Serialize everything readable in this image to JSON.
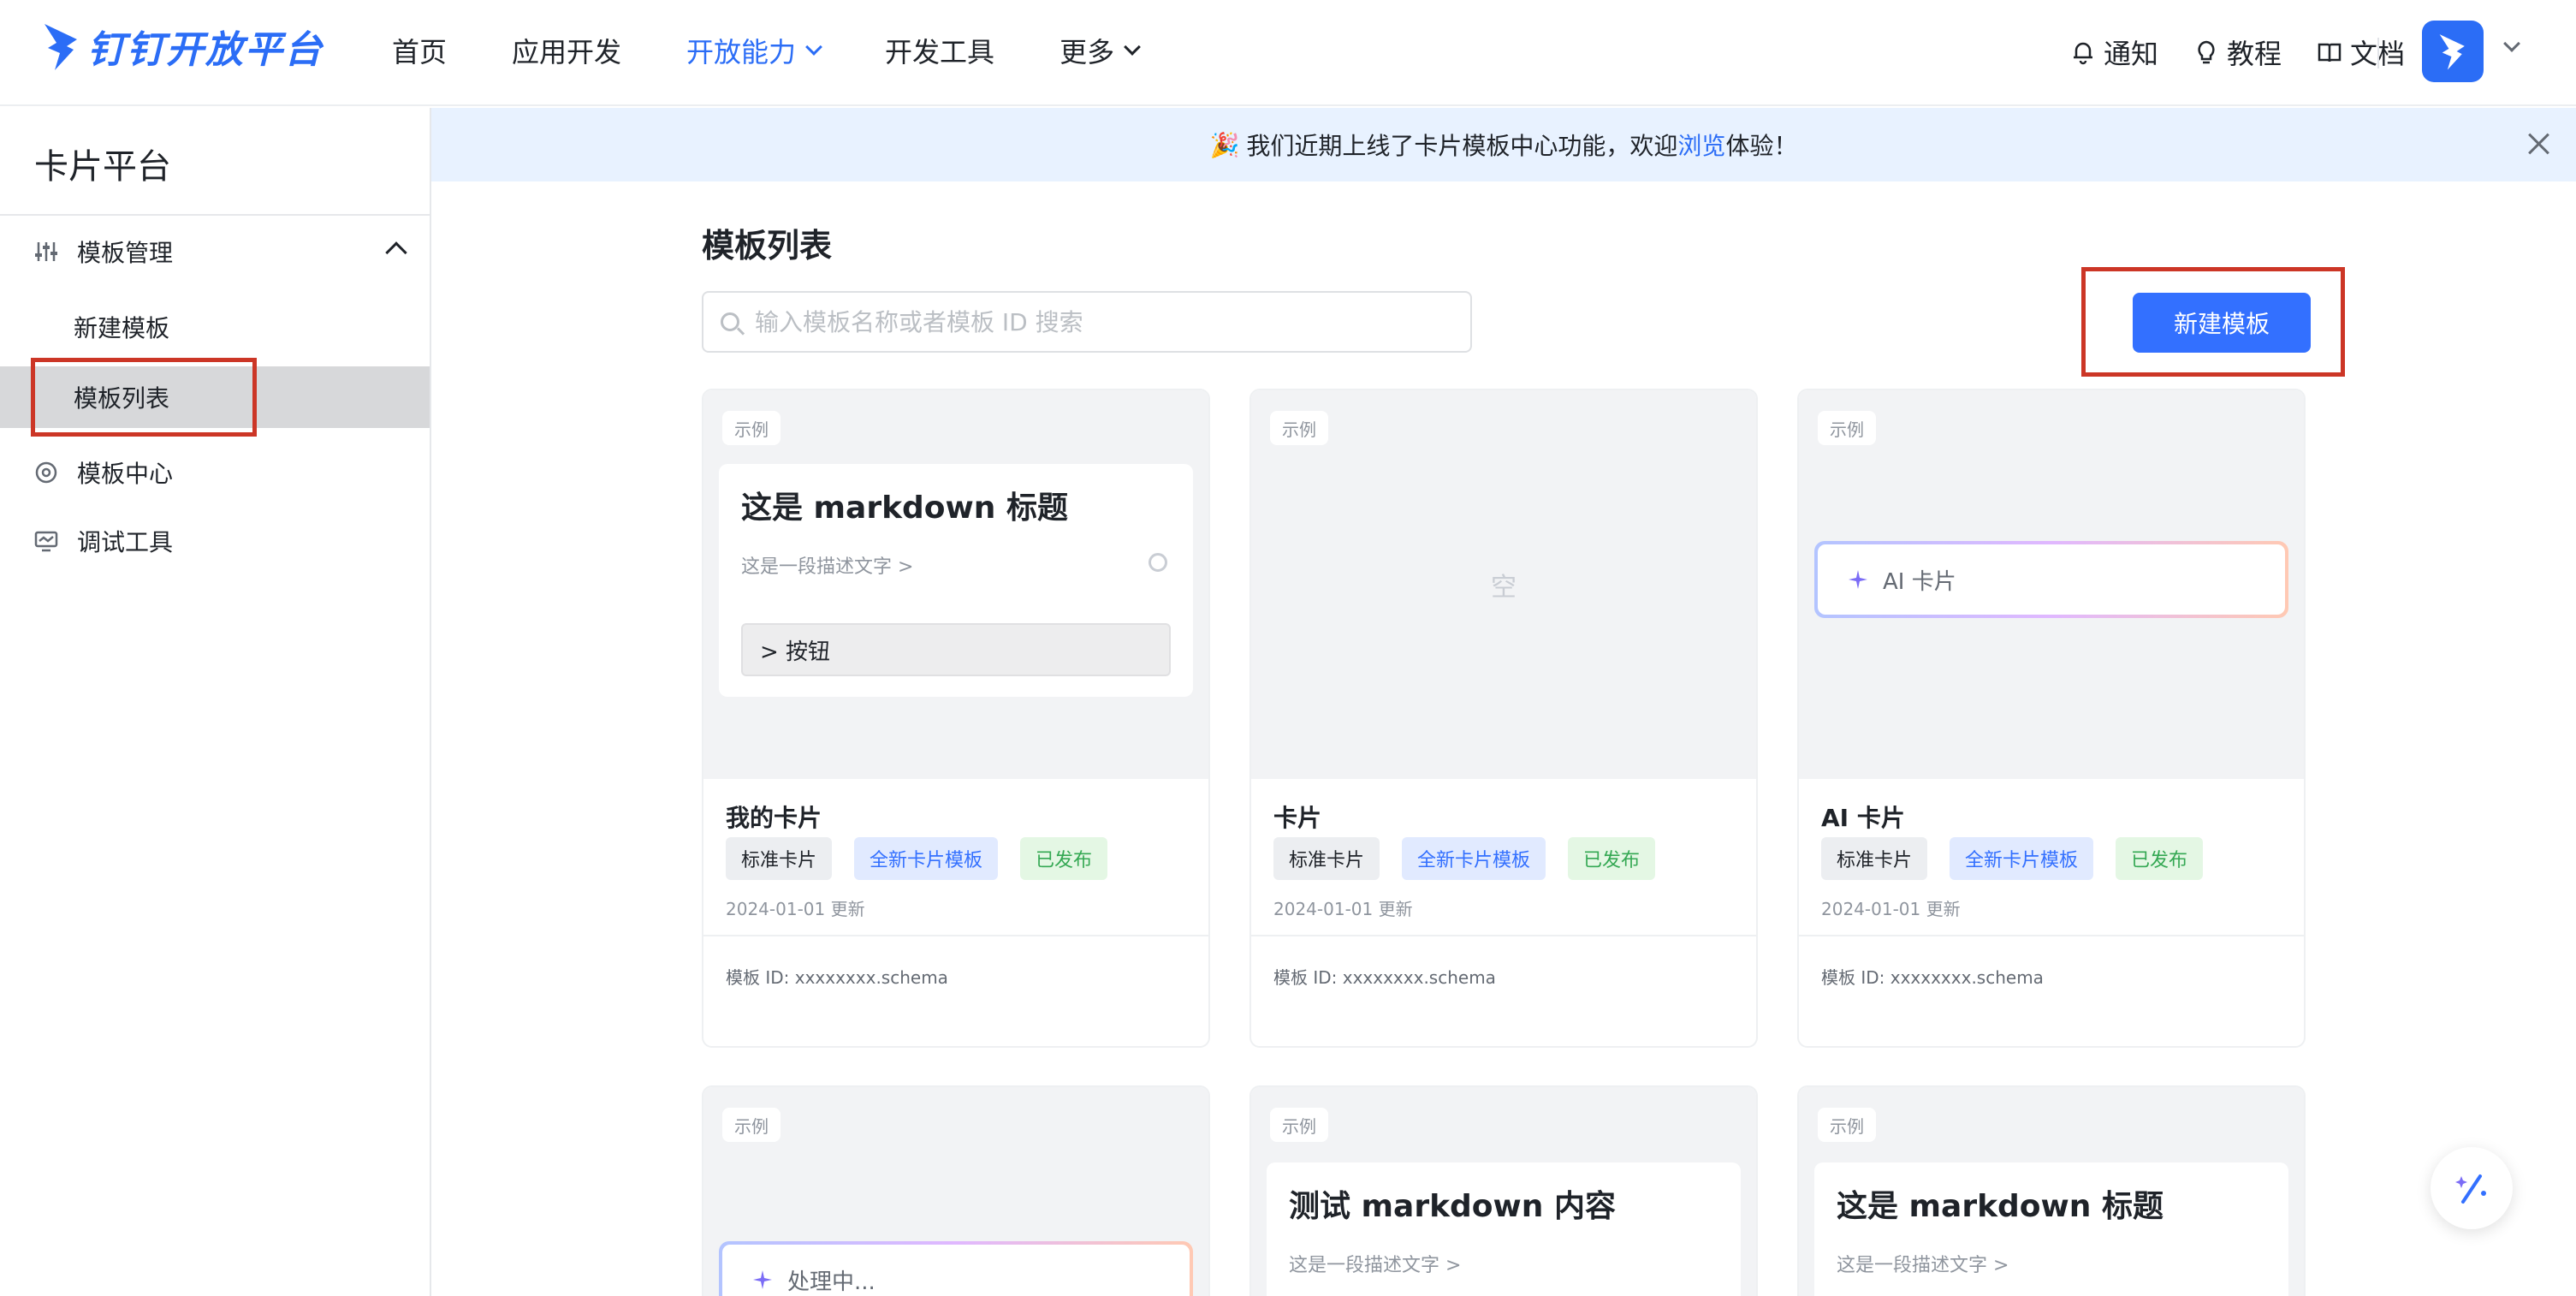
{
  "brand": {
    "name": "钉钉开放平台",
    "color": "#2b6df6"
  },
  "nav": {
    "items": [
      {
        "label": "首页"
      },
      {
        "label": "应用开发"
      },
      {
        "label": "开放能力",
        "active": true
      },
      {
        "label": "开发工具"
      },
      {
        "label": "更多"
      }
    ],
    "right": [
      {
        "label": "通知",
        "icon": "bell-icon"
      },
      {
        "label": "教程",
        "icon": "lightbulb-icon"
      },
      {
        "label": "文档",
        "icon": "book-icon"
      }
    ]
  },
  "sidebar": {
    "title": "卡片平台",
    "items": [
      {
        "label": "模板管理",
        "icon": "sliders-icon",
        "expanded": true
      },
      {
        "label": "新建模板",
        "sub": true
      },
      {
        "label": "模板列表",
        "sub": true,
        "selected": true
      },
      {
        "label": "模板中心",
        "icon": "template-center-icon"
      },
      {
        "label": "调试工具",
        "icon": "monitor-icon"
      }
    ]
  },
  "banner": {
    "emoji": "🎉",
    "text_before": "我们近期上线了卡片模板中心功能，欢迎",
    "link": "浏览",
    "text_after": "体验！"
  },
  "main": {
    "title": "模板列表",
    "search_placeholder": "输入模板名称或者模板 ID 搜索",
    "new_button": "新建模板"
  },
  "cards": [
    {
      "tag": "示例",
      "preview_title": "这是 markdown 标题",
      "preview_sub": "这是一段描述文字 >",
      "preview_button": "> 按钮",
      "name": "我的卡片",
      "badges": [
        "标准卡片",
        "全新卡片模板",
        "已发布"
      ],
      "time": "2024-01-01 更新",
      "id": "模板 ID: xxxxxxxx.schema"
    },
    {
      "tag": "示例",
      "preview_title": "",
      "preview_sub": "",
      "preview_button": "",
      "preview_center": "空",
      "name": "卡片",
      "badges": [
        "标准卡片",
        "全新卡片模板",
        "已发布"
      ],
      "time": "2024-01-01 更新",
      "id": "模板 ID: xxxxxxxx.schema"
    },
    {
      "tag": "示例",
      "preview_ai": "AI 卡片",
      "name": "AI 卡片",
      "badges": [
        "标准卡片",
        "全新卡片模板",
        "已发布"
      ],
      "time": "2024-01-01 更新",
      "id": "模板 ID: xxxxxxxx.schema"
    },
    {
      "tag": "示例",
      "preview_ai": "处理中..."
    },
    {
      "tag": "示例",
      "preview_title": "测试 markdown 内容",
      "preview_sub": "这是一段描述文字 >"
    },
    {
      "tag": "示例",
      "preview_title": "这是 markdown 标题",
      "preview_sub": "这是一段描述文字 >"
    }
  ],
  "colors": {
    "primary": "#3370ff",
    "highlight": "#cc3626",
    "banner_bg": "#e8f2ff",
    "selected_bg": "#d7d8da"
  }
}
